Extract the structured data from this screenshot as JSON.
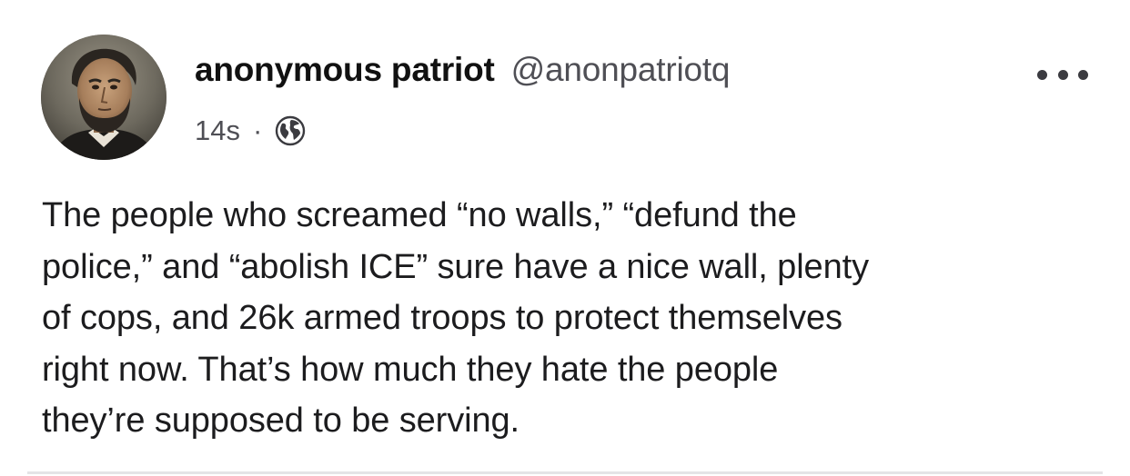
{
  "post": {
    "author": {
      "display_name": "anonymous patriot",
      "handle": "@anonpatriotq",
      "avatar_icon": "portrait-avatar"
    },
    "timestamp": "14s",
    "separator": "·",
    "visibility_icon": "globe-icon",
    "more_icon": "ellipsis-icon",
    "body_lines": [
      "The people who screamed “no walls,” “defund the",
      "police,” and “abolish ICE” sure have a nice wall, plenty",
      "of cops, and 26k armed troops to protect themselves",
      "right now. That’s how much they hate the people",
      "they’re supposed to be serving."
    ]
  },
  "colors": {
    "text": "#1c1c1e",
    "secondary_text": "#4f4f55",
    "divider": "#e4e4e6",
    "background": "#ffffff"
  }
}
